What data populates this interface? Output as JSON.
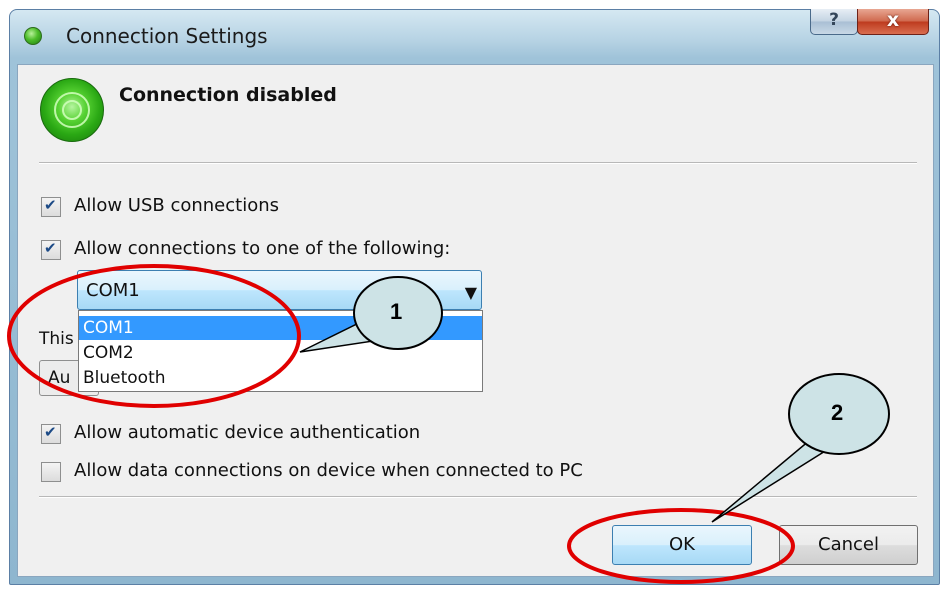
{
  "window": {
    "title": "Connection Settings",
    "help_glyph": "?",
    "close_glyph": "x"
  },
  "status": {
    "text": "Connection disabled"
  },
  "options": {
    "allow_usb": {
      "label": "Allow USB connections",
      "checked": true
    },
    "allow_following": {
      "label": "Allow connections to one of the following:",
      "checked": true
    },
    "auto_auth": {
      "label": "Allow automatic device authentication",
      "checked": true
    },
    "data_conn": {
      "label": "Allow data connections on device when connected to PC",
      "checked": false
    }
  },
  "port_combo": {
    "selected": "COM1",
    "arrow_glyph": "▼",
    "options": [
      "COM1",
      "COM2",
      "Bluetooth"
    ],
    "highlighted_index": 0
  },
  "obscured": {
    "label_fragment": "This",
    "combo_fragment": "Au"
  },
  "buttons": {
    "ok": "OK",
    "cancel": "Cancel"
  },
  "annotations": {
    "callout_1": "1",
    "callout_2": "2",
    "highlight_color": "#e00000",
    "callout_fill": "#cde3e6"
  }
}
